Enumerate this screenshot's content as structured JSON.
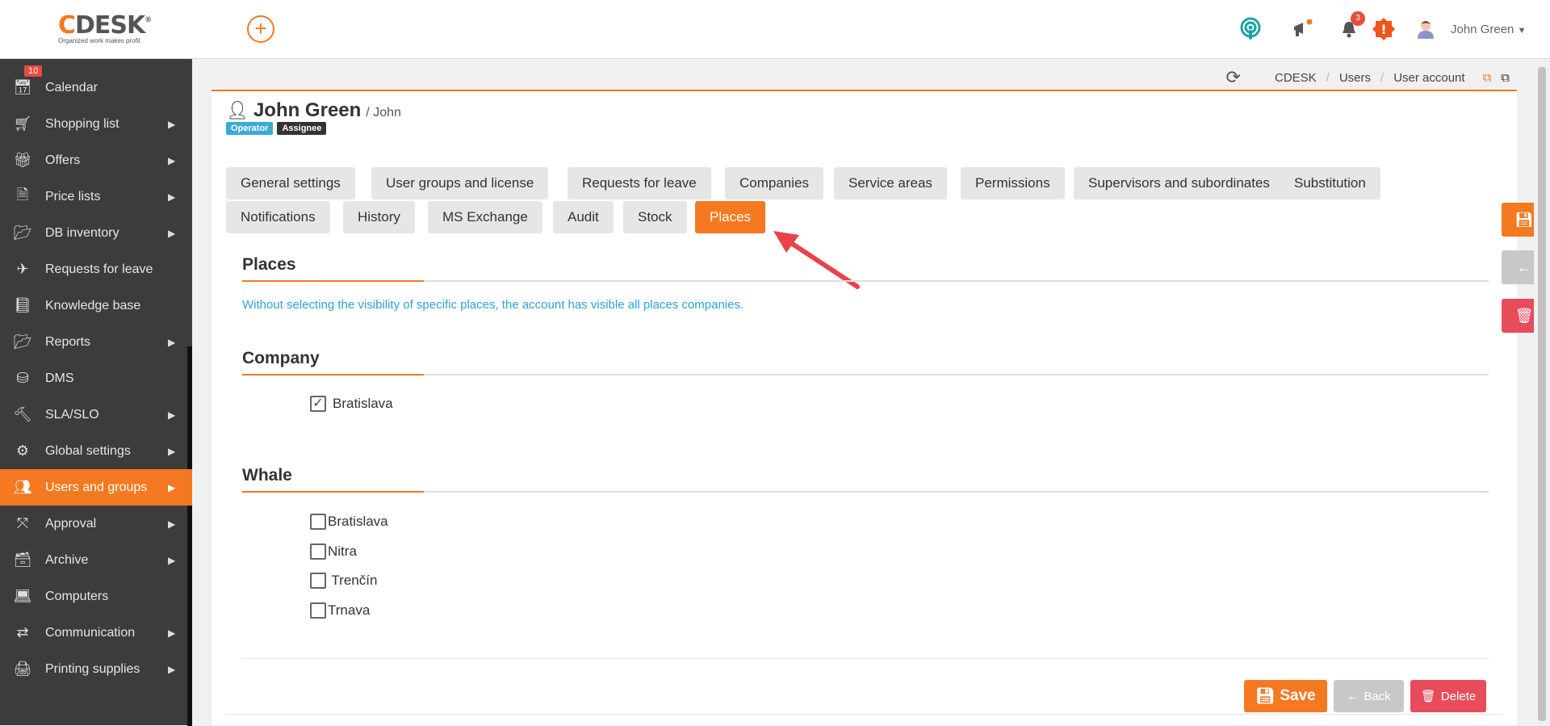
{
  "app": {
    "logo_text": "CDESK",
    "logo_tagline": "Organized work makes profit",
    "add_button": "+",
    "notifications_count": "3",
    "alert_symbol": "!",
    "user_name": "John Green"
  },
  "sidebar": {
    "calendar_badge": "10",
    "items": [
      {
        "label": "Calendar",
        "icon": "calendar-icon"
      },
      {
        "label": "Shopping list",
        "icon": "cart-icon"
      },
      {
        "label": "Offers",
        "icon": "gift-icon"
      },
      {
        "label": "Price lists",
        "icon": "file-icon"
      },
      {
        "label": "DB inventory",
        "icon": "folder-open-icon"
      },
      {
        "label": "Requests for leave",
        "icon": "plane-icon"
      },
      {
        "label": "Knowledge base",
        "icon": "book-icon"
      },
      {
        "label": "Reports",
        "icon": "folder-open-icon"
      },
      {
        "label": "DMS",
        "icon": "database-icon"
      },
      {
        "label": "SLA/SLO",
        "icon": "gavel-icon"
      },
      {
        "label": "Global settings",
        "icon": "gears-icon"
      },
      {
        "label": "Users and groups",
        "icon": "users-icon"
      },
      {
        "label": "Approval",
        "icon": "compress-icon"
      },
      {
        "label": "Archive",
        "icon": "archive-icon"
      },
      {
        "label": "Computers",
        "icon": "laptop-icon"
      },
      {
        "label": "Communication",
        "icon": "exchange-icon"
      },
      {
        "label": "Printing supplies",
        "icon": "print-icon"
      }
    ]
  },
  "breadcrumb": [
    "CDESK",
    "Users",
    "User account"
  ],
  "page": {
    "title": "John Green",
    "subtitle": "/ John",
    "roles": [
      "Operator",
      "Assignee"
    ]
  },
  "tabs": [
    "General settings",
    "User groups and license",
    "Requests for leave",
    "Companies",
    "Service areas",
    "Permissions",
    "Supervisors and subordinates",
    "Substitution",
    "Notifications",
    "History",
    "MS Exchange",
    "Audit",
    "Stock",
    "Places"
  ],
  "places": {
    "heading": "Places",
    "info": "Without selecting the visibility of specific places, the account has visible all places companies.",
    "company_heading": "Company",
    "company_items": [
      {
        "label": "Bratislava",
        "checked": true
      }
    ],
    "whale_heading": "Whale",
    "whale_items": [
      {
        "label": "Bratislava",
        "checked": false
      },
      {
        "label": "Nitra",
        "checked": false
      },
      {
        "label": " Trenčín",
        "checked": false
      },
      {
        "label": "Trnava",
        "checked": false
      }
    ]
  },
  "actions": {
    "save": "Save",
    "back": "Back",
    "delete": "Delete"
  },
  "colors": {
    "accent": "#f47920",
    "operator": "#3aaad7",
    "assignee": "#333333",
    "delete": "#e84c5a",
    "back": "#c8c8c8"
  }
}
